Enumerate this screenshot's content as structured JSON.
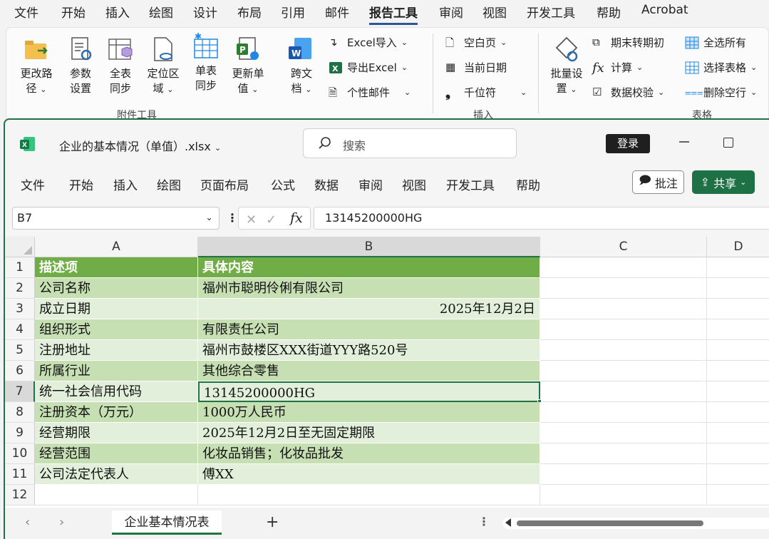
{
  "word": {
    "menu": [
      "文件",
      "开始",
      "插入",
      "绘图",
      "设计",
      "布局",
      "引用",
      "邮件",
      "报告工具",
      "审阅",
      "视图",
      "开发工具",
      "帮助",
      "Acrobat"
    ],
    "active_menu": "报告工具",
    "ribbon": {
      "big_buttons": [
        {
          "line1": "更改路",
          "line2": "径"
        },
        {
          "line1": "参数",
          "line2": "设置"
        },
        {
          "line1": "全表",
          "line2": "同步"
        },
        {
          "line1": "定位区",
          "line2": "域"
        },
        {
          "line1": "单表",
          "line2": "同步"
        },
        {
          "line1": "更新单",
          "line2": "值"
        },
        {
          "line1": "跨文",
          "line2": "档"
        }
      ],
      "small_buttons": {
        "excel_import": "Excel导入",
        "export_excel": "导出Excel",
        "personal_mail": "个性邮件",
        "blank_page": "空白页",
        "current_date": "当前日期",
        "thousands_sep": "千位符",
        "batch_settings_1": "批量设",
        "batch_settings_2": "置",
        "period_carry": "期末转期初",
        "calculate": "计算",
        "data_validation": "数据校验",
        "select_all": "全选所有",
        "select_table": "选择表格",
        "delete_empty_rows": "删除空行"
      },
      "groups": [
        "附件工具",
        "插入",
        "表格"
      ]
    }
  },
  "excel": {
    "filename": "企业的基本情况（单值）.xlsx",
    "search_placeholder": "搜索",
    "login": "登录",
    "menu": [
      "文件",
      "开始",
      "插入",
      "绘图",
      "页面布局",
      "公式",
      "数据",
      "审阅",
      "视图",
      "开发工具",
      "帮助"
    ],
    "comment_button": "批注",
    "share_button": "共享",
    "name_box": "B7",
    "formula_value": "13145200000HG",
    "columns": [
      "A",
      "B",
      "C",
      "D"
    ],
    "rows": [
      "1",
      "2",
      "3",
      "4",
      "5",
      "6",
      "7",
      "8",
      "9",
      "10",
      "11",
      "12"
    ],
    "table": [
      [
        "描述项",
        "具体内容"
      ],
      [
        "公司名称",
        "福州市聪明伶俐有限公司"
      ],
      [
        "成立日期",
        "2025年12月2日"
      ],
      [
        "组织形式",
        "有限责任公司"
      ],
      [
        "注册地址",
        "福州市鼓楼区XXX街道YYY路520号"
      ],
      [
        "所属行业",
        "其他综合零售"
      ],
      [
        "统一社会信用代码",
        "13145200000HG"
      ],
      [
        "注册资本（万元）",
        "1000万人民币"
      ],
      [
        "经营期限",
        "2025年12月2日至无固定期限"
      ],
      [
        "经营范围",
        "化妆品销售；化妆品批发"
      ],
      [
        "公司法定代表人",
        "傅XX"
      ]
    ],
    "active_cell": "B7",
    "sheet_tab": "企业基本情况表",
    "colors": {
      "header_green": "#70ad47",
      "band_dark": "#c6e0b4",
      "band_light": "#e2efda",
      "excel_green": "#217346"
    }
  }
}
